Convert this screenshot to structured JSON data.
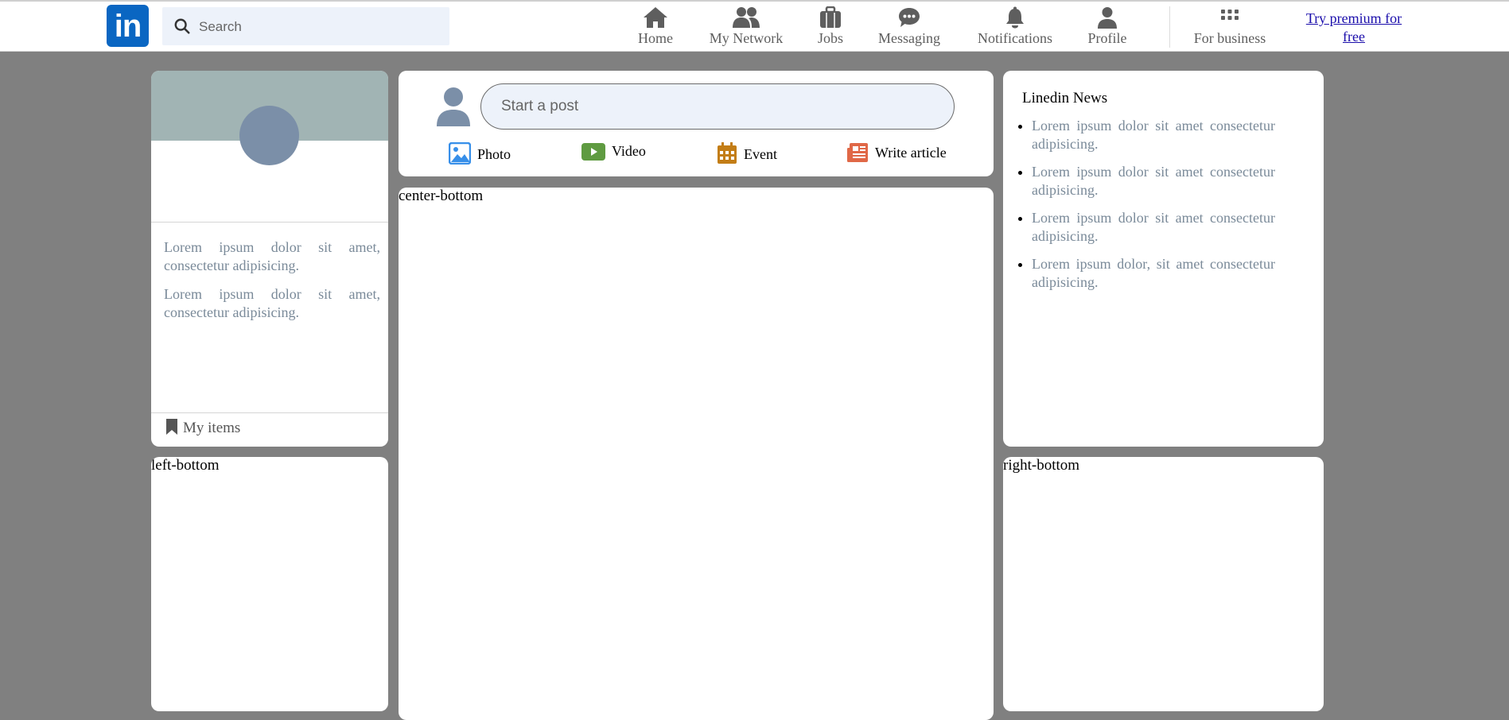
{
  "header": {
    "logo_text": "in",
    "search_placeholder": "Search",
    "nav": [
      {
        "label": "Home",
        "icon": "home-icon"
      },
      {
        "label": "My Network",
        "icon": "network-icon"
      },
      {
        "label": "Jobs",
        "icon": "briefcase-icon"
      },
      {
        "label": "Messaging",
        "icon": "message-icon"
      },
      {
        "label": "Notifications",
        "icon": "bell-icon"
      },
      {
        "label": "Profile",
        "icon": "user-icon"
      },
      {
        "label": "For business",
        "icon": "grid-icon"
      }
    ],
    "premium_link": "Try premium for free"
  },
  "left": {
    "texts": [
      "Lorem ipsum dolor sit amet, consectetur adipisicing.",
      "Lorem ipsum dolor sit amet, consectetur adipisicing."
    ],
    "my_items": "My items",
    "bottom_label": "left-bottom"
  },
  "center": {
    "post_placeholder": "Start a post",
    "actions": [
      {
        "label": "Photo",
        "icon": "photo-icon",
        "color": "#378fe9"
      },
      {
        "label": "Video",
        "icon": "video-icon",
        "color": "#5f9b41"
      },
      {
        "label": "Event",
        "icon": "calendar-icon",
        "color": "#c37d16"
      },
      {
        "label": "Write article",
        "icon": "article-icon",
        "color": "#e06847"
      }
    ],
    "bottom_label": "center-bottom"
  },
  "right": {
    "news_title": "Linedin News",
    "news": [
      "Lorem ipsum dolor sit amet consectetur adipisicing.",
      "Lorem ipsum dolor sit amet consectetur adipisicing.",
      "Lorem ipsum dolor sit amet consectetur adipisicing.",
      "Lorem ipsum dolor, sit amet consectetur adipisicing."
    ],
    "bottom_label": "right-bottom"
  },
  "colors": {
    "page_bg": "#808080",
    "brand": "#0a66c2",
    "nav_icon": "#5e5e5e",
    "muted_text": "#7a8a99",
    "link": "#1a0dab"
  }
}
